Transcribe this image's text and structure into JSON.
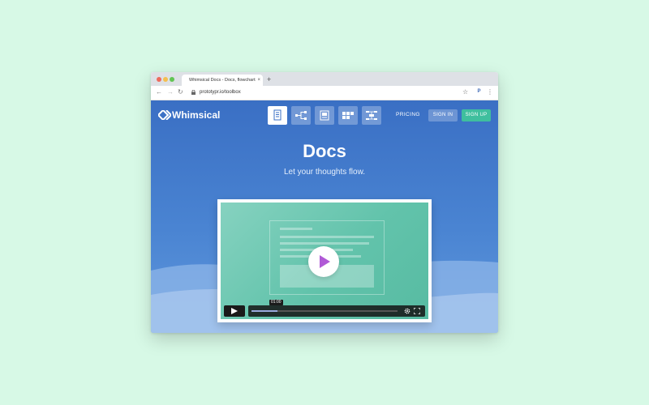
{
  "browser": {
    "tab_title": "Whimsical Docs - Docs, flowcharts",
    "tab_close": "×",
    "new_tab": "+",
    "nav": {
      "back": "←",
      "forward": "→",
      "reload": "↻"
    },
    "url": "prototypr.io/toolbox",
    "star": "☆",
    "extension": "P",
    "menu": "⋮"
  },
  "site": {
    "logo_text": "Whimsical",
    "tools": [
      {
        "name": "docs",
        "active": true
      },
      {
        "name": "flowcharts",
        "active": false
      },
      {
        "name": "wireframes",
        "active": false
      },
      {
        "name": "sticky-notes",
        "active": false
      },
      {
        "name": "mind-maps",
        "active": false
      }
    ],
    "nav_pricing": "PRICING",
    "sign_in": "SIGN IN",
    "sign_up": "SIGN UP"
  },
  "hero": {
    "title": "Docs",
    "subtitle": "Let your thoughts flow."
  },
  "video": {
    "time": "01:00",
    "progress": 0.18
  },
  "colors": {
    "background": "#d7f9e6",
    "page_blue": "#3a6fc4",
    "signup_green": "#3fbf9e",
    "play_purple": "#b05ad6",
    "video_teal": "#62c3ab"
  }
}
